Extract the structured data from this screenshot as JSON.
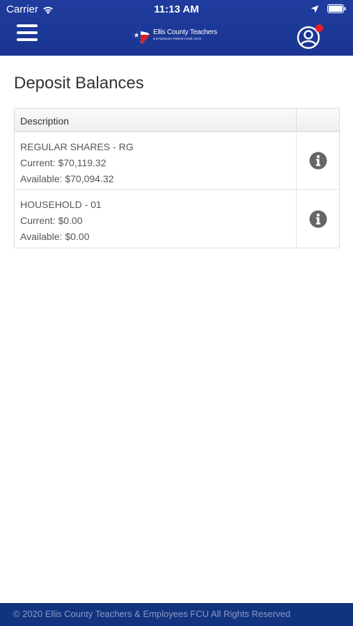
{
  "status_bar": {
    "carrier": "Carrier",
    "time": "11:13 AM"
  },
  "header": {
    "logo_title": "Ellis County Teachers",
    "logo_subtitle": "& Employees Federal Credit Union"
  },
  "page": {
    "title": "Deposit Balances"
  },
  "table": {
    "header_description": "Description",
    "rows": [
      {
        "name": "REGULAR SHARES - RG",
        "current": "Current: $70,119.32",
        "available": "Available: $70,094.32"
      },
      {
        "name": "HOUSEHOLD - 01",
        "current": "Current: $0.00",
        "available": "Available: $0.00"
      }
    ]
  },
  "footer": {
    "text": "© 2020 Ellis County Teachers & Employees FCU All Rights Reserved"
  },
  "colors": {
    "header_bg": "#1f3c9e",
    "footer_bg": "#12337e",
    "notification": "#e8202a",
    "info_icon": "#666666"
  },
  "icons": [
    "wifi-icon",
    "location-arrow-icon",
    "battery-icon",
    "hamburger-menu-icon",
    "texas-flag-logo",
    "user-profile-icon",
    "info-icon"
  ]
}
